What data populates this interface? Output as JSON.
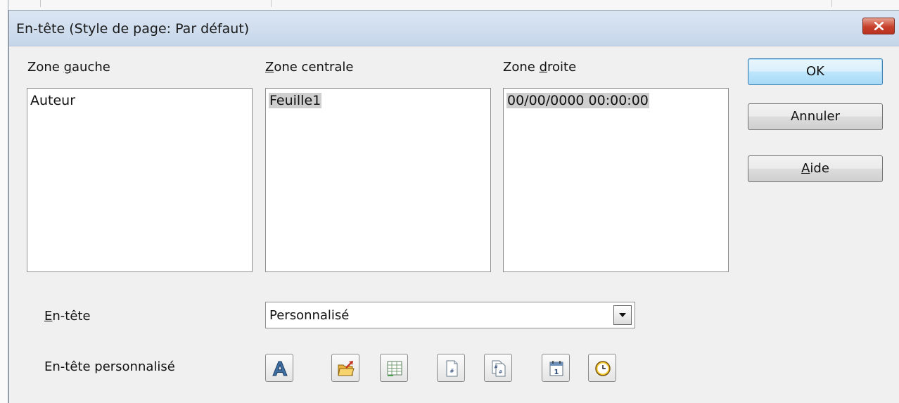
{
  "dialog": {
    "title": "En-tête (Style de page: Par défaut)"
  },
  "zones": [
    {
      "label_pre": "Zone ",
      "label_key": "g",
      "label_post": "auche",
      "content": "Auteur",
      "highlighted": false
    },
    {
      "label_pre": "",
      "label_key": "Z",
      "label_post": "one centrale",
      "content": "Feuille1",
      "highlighted": true
    },
    {
      "label_pre": "Zone ",
      "label_key": "d",
      "label_post": "roite",
      "content": "00/00/0000 00:00:00",
      "highlighted": true
    }
  ],
  "buttons": {
    "ok": "OK",
    "cancel": "Annuler",
    "help_key": "A",
    "help_rest": "ide"
  },
  "header_row": {
    "label_key": "E",
    "label_rest": "n-tête",
    "selected": "Personnalisé"
  },
  "custom_row": {
    "label": "En-tête personnalisé"
  },
  "toolbar_icons": [
    "text-attributes-icon",
    "title-icon",
    "sheet-name-icon",
    "page-icon",
    "pages-icon",
    "date-icon",
    "time-icon"
  ],
  "colors": {
    "close_button": "#c7402b",
    "default_button_border": "#3c7fb1",
    "highlight": "#cfcfcf"
  }
}
